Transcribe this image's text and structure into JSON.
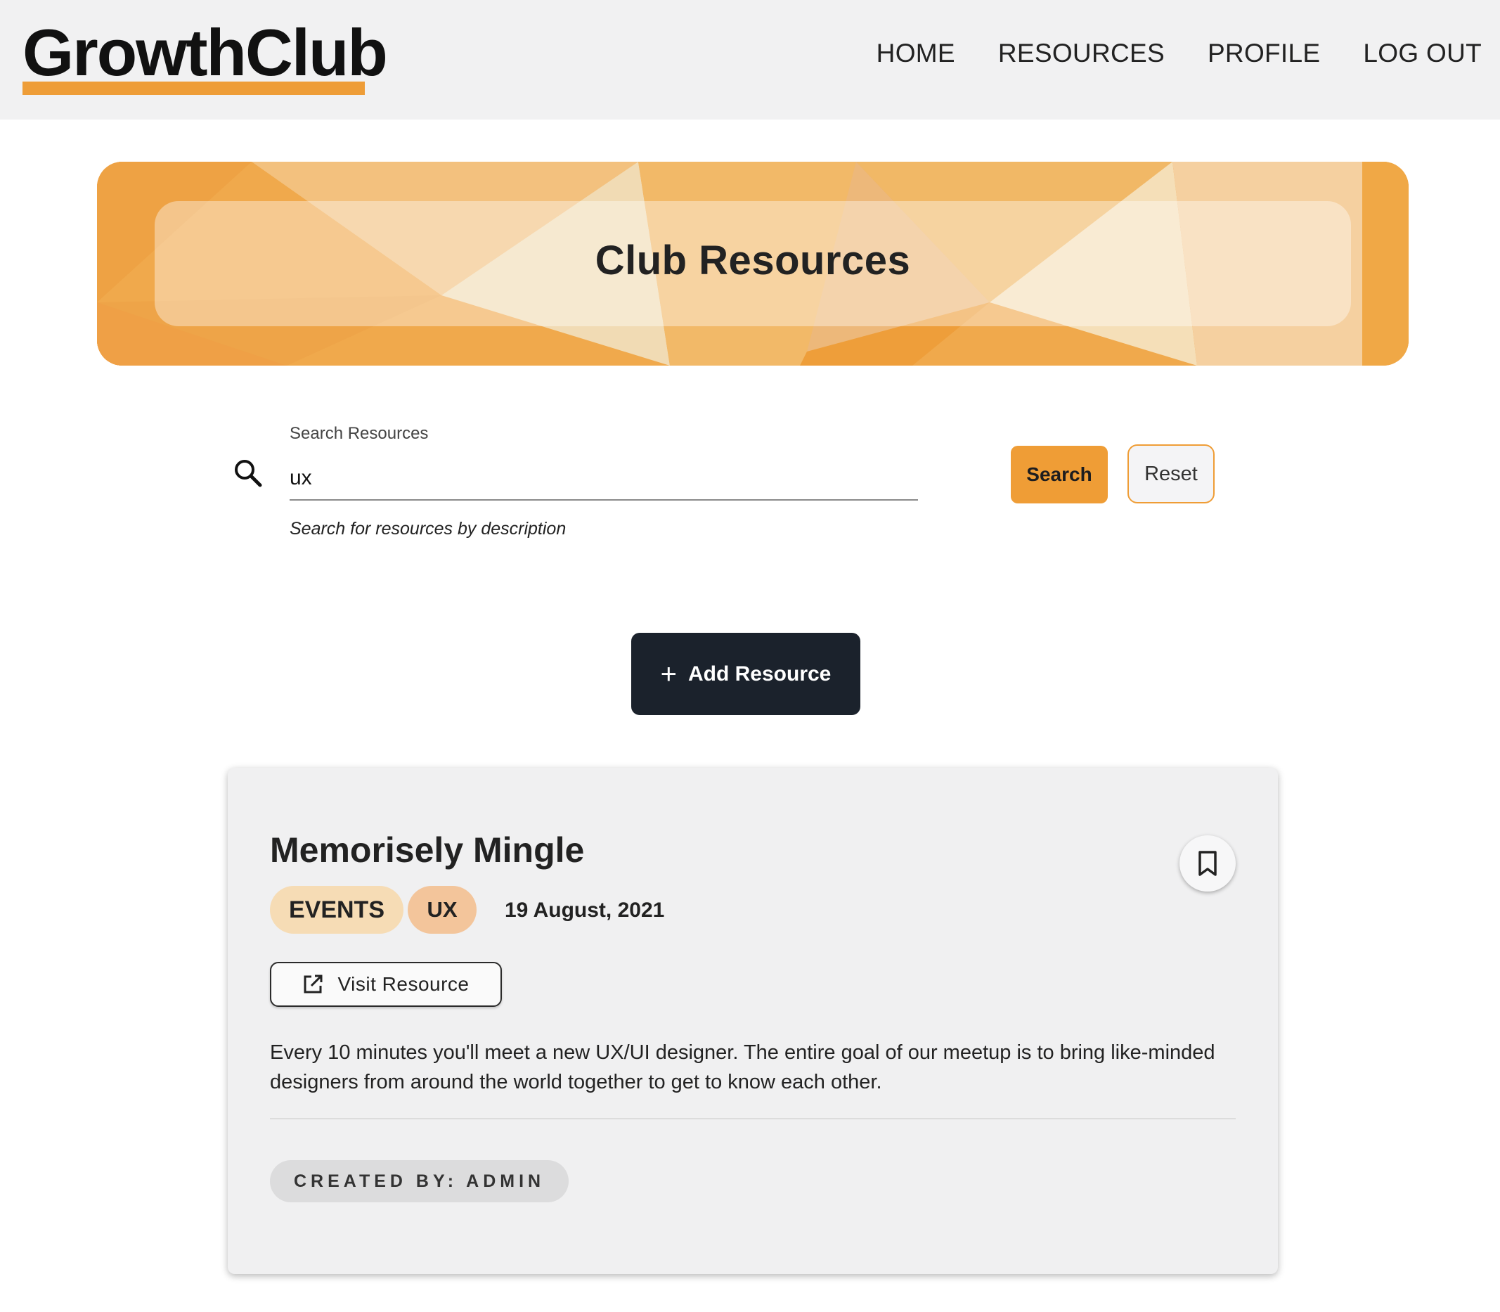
{
  "header": {
    "logo": "GrowthClub",
    "nav": [
      "HOME",
      "RESOURCES",
      "PROFILE",
      "LOG OUT"
    ],
    "accent_color": "#ee9d38"
  },
  "hero": {
    "title": "Club Resources"
  },
  "search": {
    "label": "Search Resources",
    "value": "ux",
    "hint": "Search for resources by description",
    "search_button": "Search",
    "reset_button": "Reset",
    "icon": "search-icon"
  },
  "add_button": {
    "label": "Add Resource",
    "icon": "plus-icon"
  },
  "resource": {
    "title": "Memorisely Mingle",
    "tags": [
      "EVENTS",
      "UX"
    ],
    "date": "19 August, 2021",
    "visit_label": "Visit Resource",
    "visit_icon": "external-link-icon",
    "bookmark_icon": "bookmark-icon",
    "description": "Every 10 minutes you'll meet a new UX/UI designer. The entire goal of our meetup is to bring like-minded designers from around the world together to get to know each other.",
    "created_by": "CREATED BY: ADMIN"
  }
}
